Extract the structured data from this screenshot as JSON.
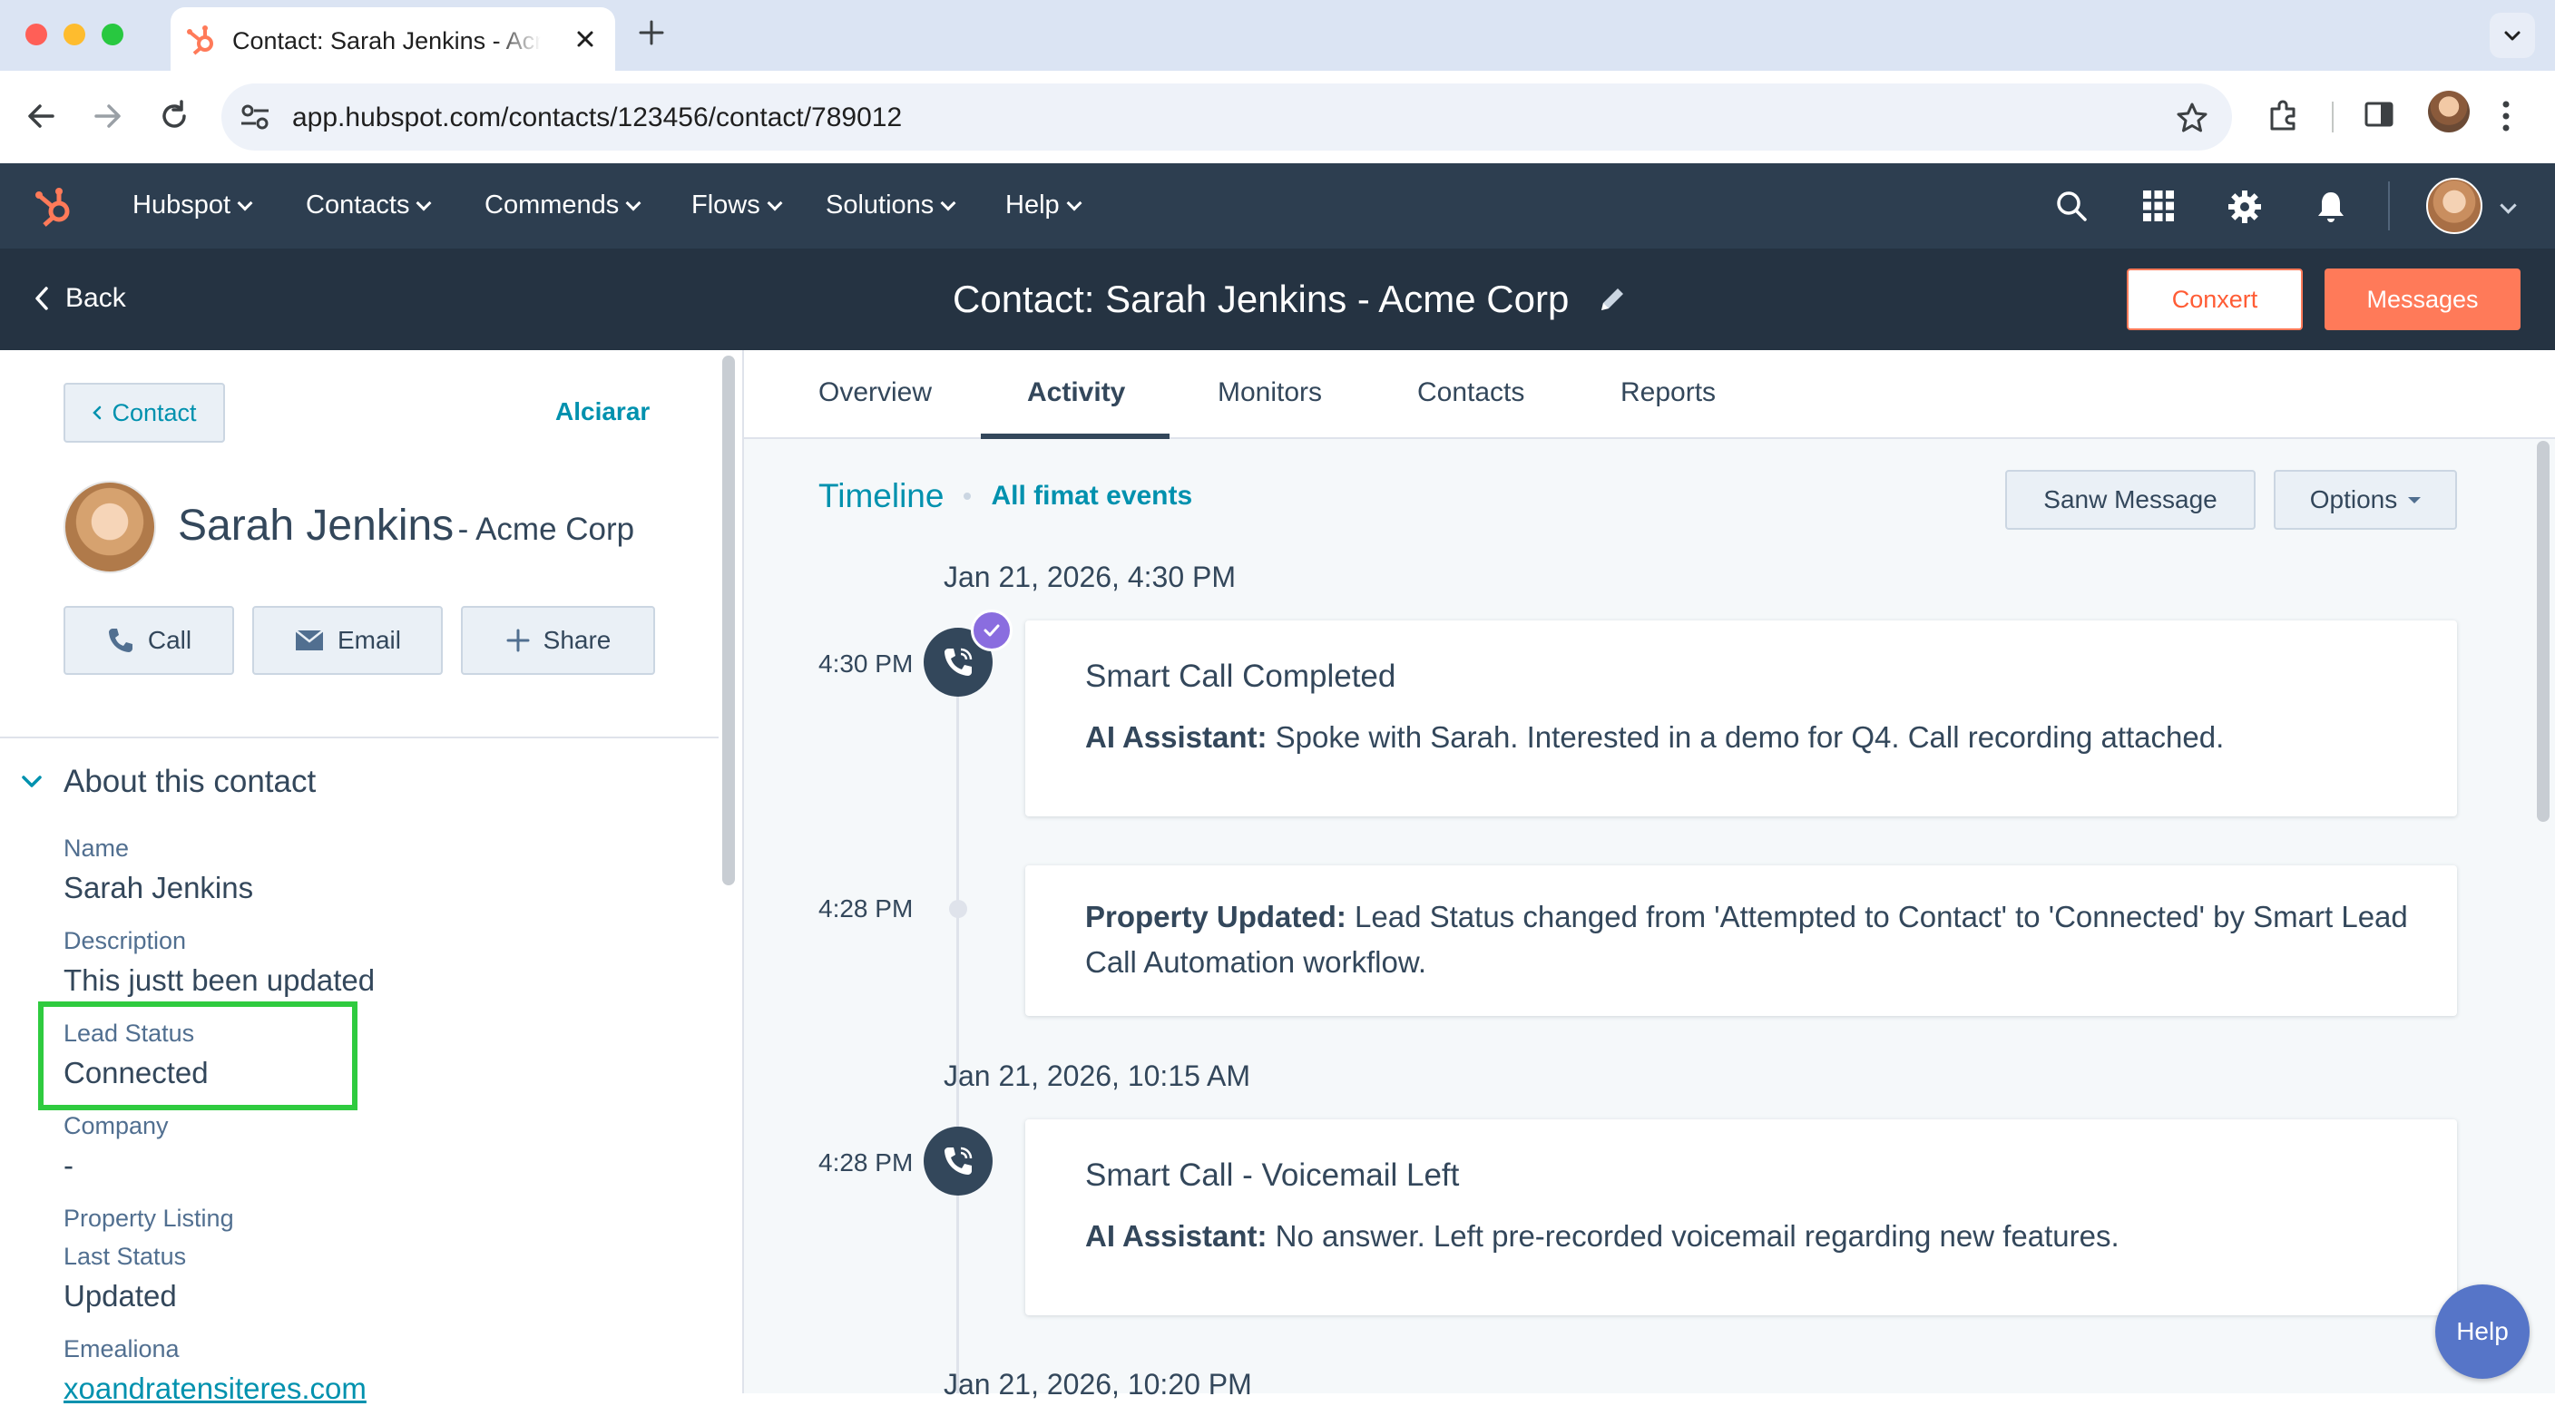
{
  "browser": {
    "tab_title": "Contact: Sarah Jenkins - Acme Corp",
    "url": "app.hubspot.com/contacts/123456/contact/789012"
  },
  "hubspot_nav": {
    "items": [
      {
        "label": "Hubspot"
      },
      {
        "label": "Contacts"
      },
      {
        "label": "Commends"
      },
      {
        "label": "Flows"
      },
      {
        "label": "Solutions"
      },
      {
        "label": "Help"
      }
    ]
  },
  "page_header": {
    "back_label": "Back",
    "title": "Contact: Sarah Jenkins - Acme Corp",
    "convert_label": "Conxert",
    "messages_label": "Messages"
  },
  "contact": {
    "crumb_label": "Contact",
    "actions_label": "Alciarar",
    "name": "Sarah Jenkins",
    "company_suffix": "- Acme Corp",
    "call_label": "Call",
    "email_label": "Email",
    "share_label": "Share",
    "about_label": "About this contact",
    "properties": {
      "name_label": "Name",
      "name_value": "Sarah Jenkins",
      "description_label": "Description",
      "description_value": "This justt been updated",
      "lead_status_label": "Lead Status",
      "lead_status_value": "Connected",
      "company_label": "Company",
      "company_value": "-",
      "property_listing_label": "Property Listing",
      "last_status_label": "Last Status",
      "last_status_value": "Updated",
      "email_label": "Emealiona",
      "email_value": "xoandratensiteres.com"
    }
  },
  "tabs": [
    {
      "label": "Overview"
    },
    {
      "label": "Activity",
      "active": true
    },
    {
      "label": "Monitors"
    },
    {
      "label": "Contacts"
    },
    {
      "label": "Reports"
    }
  ],
  "timeline": {
    "title": "Timeline",
    "filter_label": "All fimat events",
    "saw_message_label": "Sanw Message",
    "options_label": "Options",
    "groups": [
      {
        "date": "Jan 21, 2026, 4:30 PM"
      },
      {
        "date": "Jan 21, 2026, 10:15 AM"
      },
      {
        "date": "Jan 21, 2026, 10:20 PM"
      }
    ],
    "events": [
      {
        "time": "4:30 PM",
        "title": "Smart Call Completed",
        "body_prefix": "AI Assistant:",
        "body": "Spoke with Sarah. Interested in a demo for Q4. Call recording attached."
      },
      {
        "time": "4:28 PM",
        "body_prefix": "Property Updated:",
        "body": "Lead Status changed from 'Attempted to Contact' to 'Connected' by Smart Lead Call Automation workflow."
      },
      {
        "time": "4:28 PM",
        "title": "Smart Call - Voicemail Left",
        "body_prefix": "AI Assistant:",
        "body": "No answer. Left pre-recorded voicemail regarding new features."
      }
    ]
  },
  "help_label": "Help",
  "colors": {
    "hubspot_orange": "#ff7a59",
    "nav_dark": "#2d3e50",
    "header_dark": "#253342",
    "link_teal": "#0091ae",
    "highlight_green": "#2fcb3f",
    "badge_purple": "#8a6ddf"
  }
}
